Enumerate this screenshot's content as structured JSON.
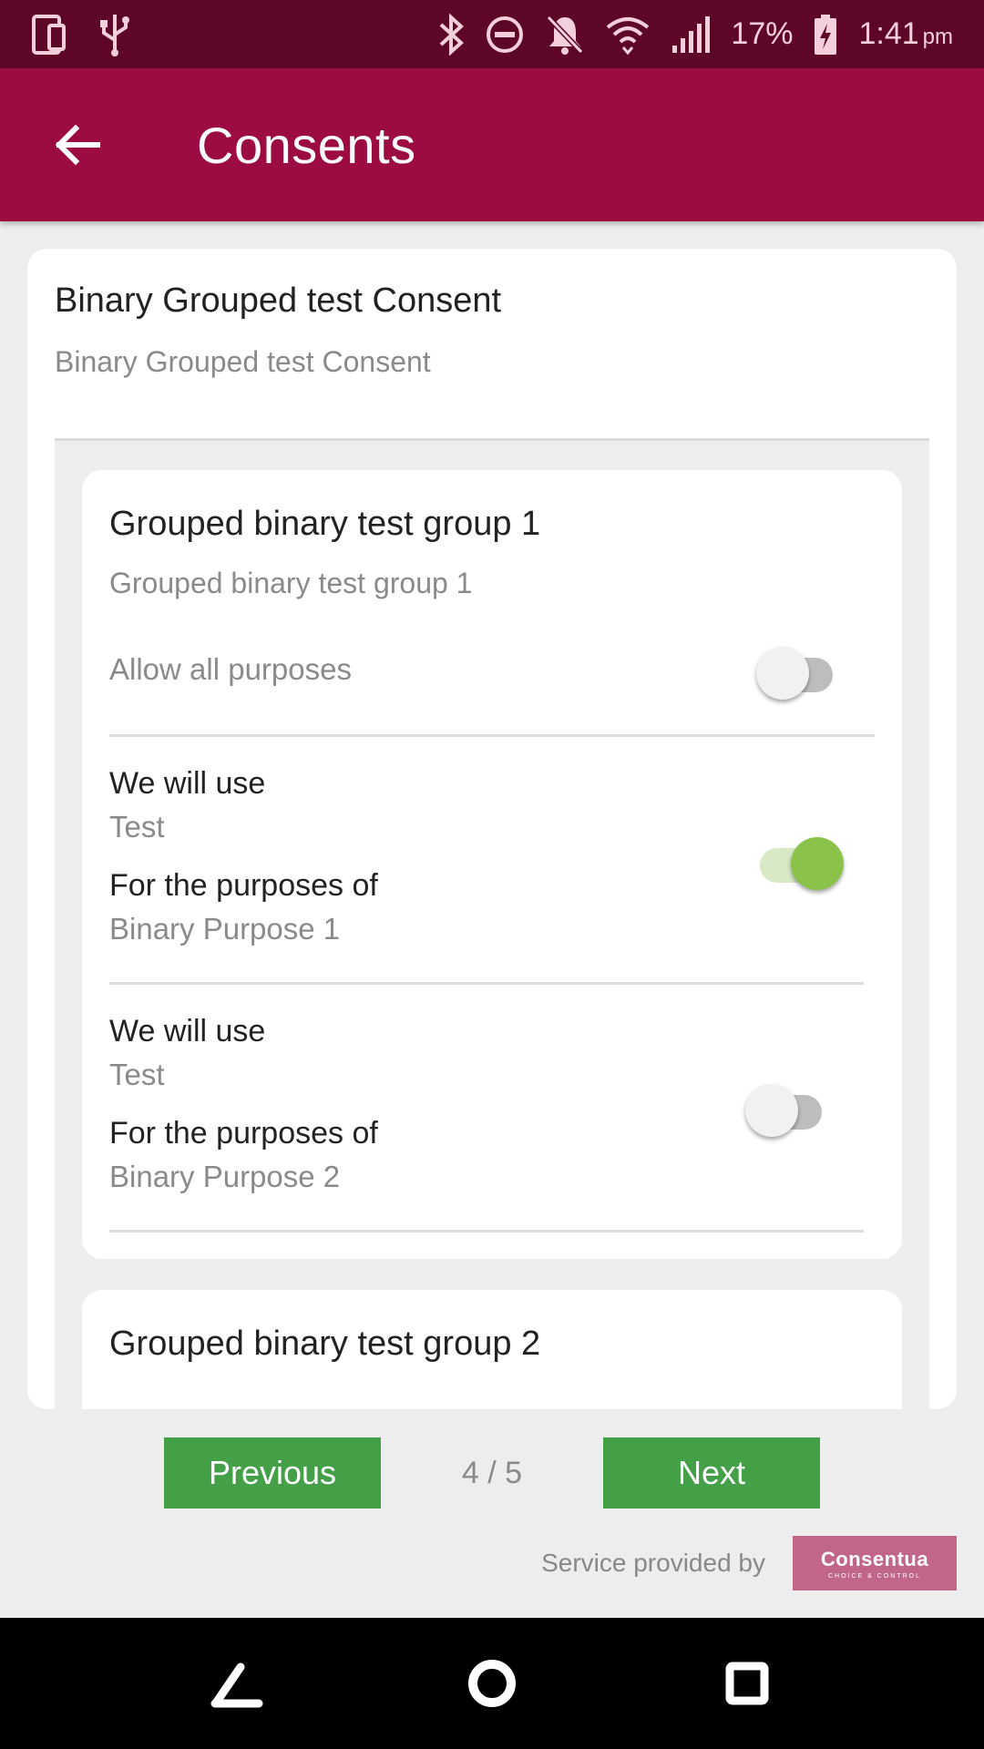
{
  "status_bar": {
    "battery": "17%",
    "time": "1:41",
    "time_suffix": "pm",
    "icons": [
      "phone-device-icon",
      "usb-icon",
      "bluetooth-icon",
      "do-not-disturb-icon",
      "notifications-off-icon",
      "wifi-icon",
      "signal-icon",
      "battery-charging-icon"
    ]
  },
  "app_bar": {
    "title": "Consents",
    "back_icon": "arrow-left-icon"
  },
  "consent": {
    "title": "Binary Grouped test Consent",
    "subtitle": "Binary Grouped test Consent"
  },
  "groups": [
    {
      "title": "Grouped binary test group 1",
      "description": "Grouped binary test group 1",
      "allow_all_label": "Allow all purposes",
      "allow_all_on": false,
      "purposes": [
        {
          "use_label": "We will use",
          "use_value": "Test",
          "purpose_label": "For the purposes of",
          "purpose_value": "Binary Purpose 1",
          "on": true
        },
        {
          "use_label": "We will use",
          "use_value": "Test",
          "purpose_label": "For the purposes of",
          "purpose_value": "Binary Purpose 2",
          "on": false
        }
      ]
    },
    {
      "title": "Grouped binary test group 2"
    }
  ],
  "pager": {
    "previous_label": "Previous",
    "next_label": "Next",
    "page_indicator": "4 / 5"
  },
  "footer": {
    "service_text": "Service provided by",
    "logo_text": "Consentua",
    "logo_tagline": "CHOICE & CONTROL"
  },
  "colors": {
    "status_bar": "#5e0628",
    "app_bar": "#9c0c42",
    "button_green": "#43a047",
    "toggle_on": "#8bc34a",
    "logo_bg": "#c2658a"
  }
}
